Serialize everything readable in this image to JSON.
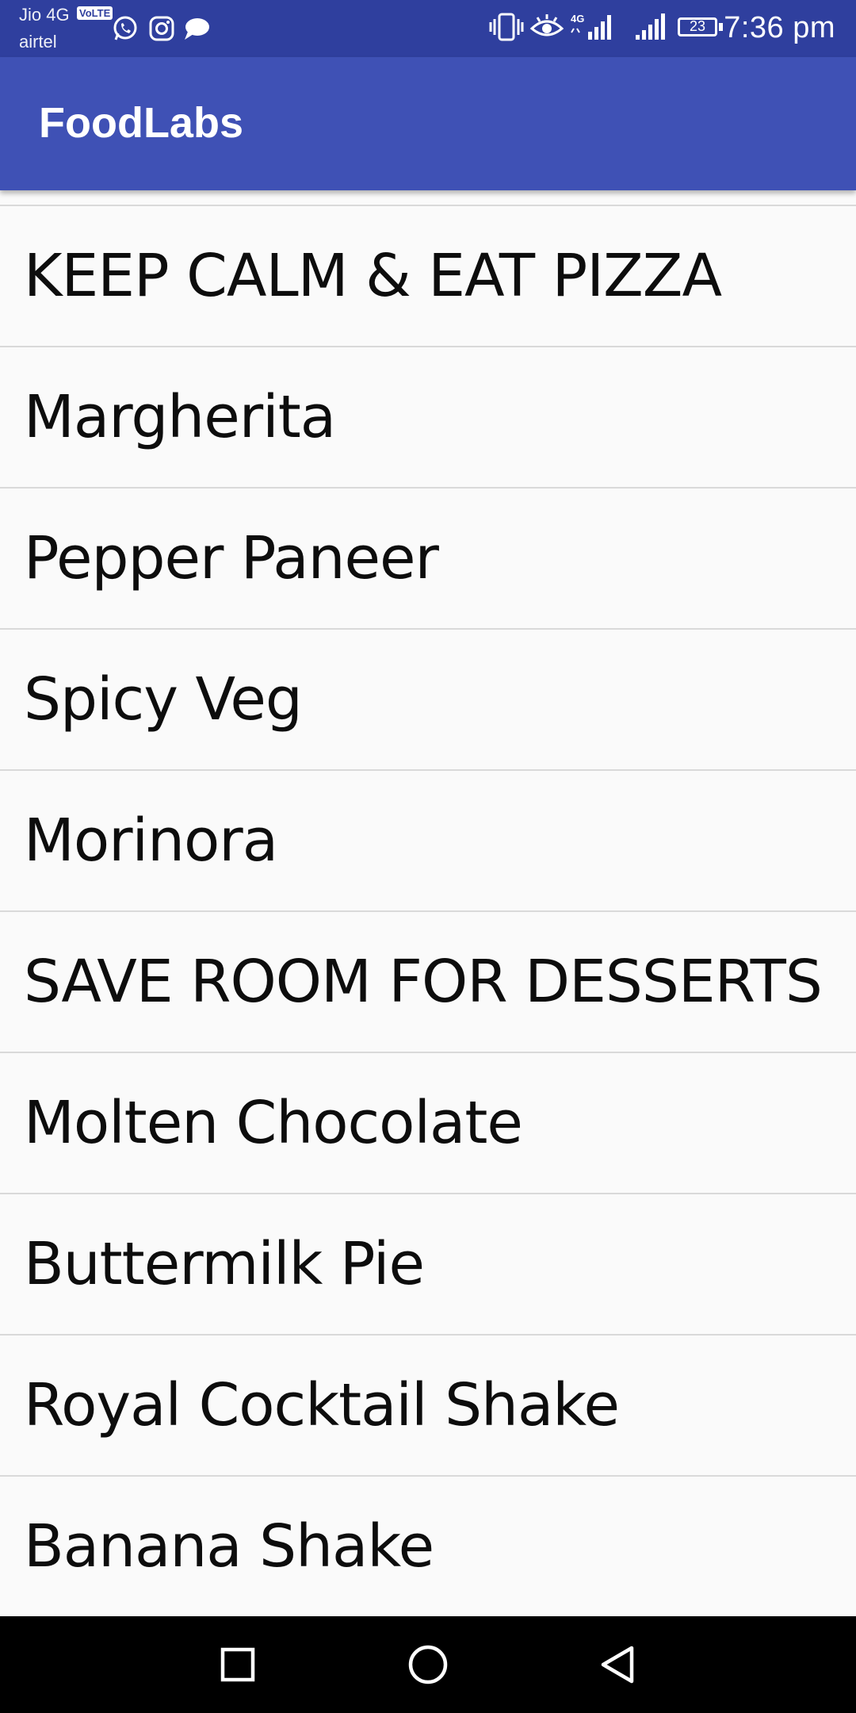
{
  "status_bar": {
    "carrier_primary": "Jio 4G",
    "volte_badge": "VoLTE",
    "carrier_secondary": "airtel",
    "network_label": "4G",
    "battery_level": "23",
    "time": "7:36 pm",
    "colors": {
      "background": "#2f3f9e",
      "text": "#ffffff"
    }
  },
  "app_bar": {
    "title": "FoodLabs",
    "color": "#3f51b5"
  },
  "menu": {
    "items": [
      {
        "label": "KEEP CALM & EAT PIZZA"
      },
      {
        "label": "Margherita"
      },
      {
        "label": "Pepper Paneer"
      },
      {
        "label": "Spicy Veg"
      },
      {
        "label": "Morinora"
      },
      {
        "label": "SAVE ROOM FOR DESSERTS"
      },
      {
        "label": "Molten Chocolate"
      },
      {
        "label": "Buttermilk Pie"
      },
      {
        "label": "Royal Cocktail Shake"
      },
      {
        "label": "Banana Shake"
      }
    ]
  },
  "nav_bar": {
    "buttons": [
      "recents-icon",
      "home-icon",
      "back-icon"
    ]
  }
}
